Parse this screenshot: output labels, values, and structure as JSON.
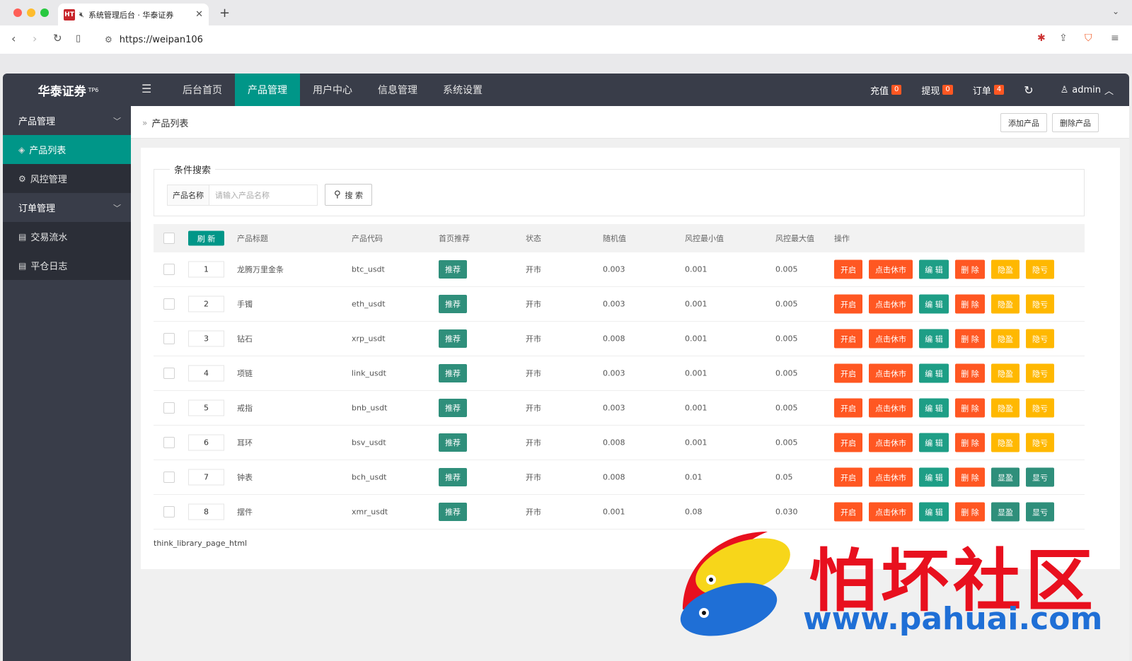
{
  "browser": {
    "tab_title": "系统管理后台 · 华泰证券",
    "tab_favicon": "HT",
    "url": "https://weipan106"
  },
  "header": {
    "logo": "华泰证券",
    "logo_sup": "TP6",
    "nav": [
      "后台首页",
      "产品管理",
      "用户中心",
      "信息管理",
      "系统设置"
    ],
    "active_nav": "产品管理",
    "recharge_label": "充值",
    "recharge_count": "0",
    "withdraw_label": "提现",
    "withdraw_count": "0",
    "order_label": "订单",
    "order_count": "4",
    "user": "admin"
  },
  "sidebar": {
    "group1": "产品管理",
    "items1": [
      "产品列表",
      "风控管理"
    ],
    "group2": "订单管理",
    "items2": [
      "交易流水",
      "平仓日志"
    ]
  },
  "breadcrumb": "产品列表",
  "actions": {
    "add": "添加产品",
    "delete": "删除产品"
  },
  "search": {
    "legend": "条件搜索",
    "label": "产品名称",
    "placeholder": "请输入产品名称",
    "button": "搜 索"
  },
  "table": {
    "refresh": "刷 新",
    "headers": [
      "产品标题",
      "产品代码",
      "首页推荐",
      "状态",
      "随机值",
      "风控最小值",
      "风控最大值",
      "操作"
    ],
    "recommend_label": "推荐",
    "op_labels": {
      "open": "开启",
      "close": "点击休市",
      "edit": "编 辑",
      "delete": "删 除",
      "hide_profit": "隐盈",
      "hide_loss": "隐亏",
      "show_profit": "显盈",
      "show_loss": "显亏"
    },
    "rows": [
      {
        "sort": "1",
        "title": "龙腾万里金条",
        "code": "btc_usdt",
        "status": "开市",
        "rand": "0.003",
        "min": "0.001",
        "max": "0.005",
        "visible": false
      },
      {
        "sort": "2",
        "title": "手镯",
        "code": "eth_usdt",
        "status": "开市",
        "rand": "0.003",
        "min": "0.001",
        "max": "0.005",
        "visible": false
      },
      {
        "sort": "3",
        "title": "钻石",
        "code": "xrp_usdt",
        "status": "开市",
        "rand": "0.008",
        "min": "0.001",
        "max": "0.005",
        "visible": false
      },
      {
        "sort": "4",
        "title": "项链",
        "code": "link_usdt",
        "status": "开市",
        "rand": "0.003",
        "min": "0.001",
        "max": "0.005",
        "visible": false
      },
      {
        "sort": "5",
        "title": "戒指",
        "code": "bnb_usdt",
        "status": "开市",
        "rand": "0.003",
        "min": "0.001",
        "max": "0.005",
        "visible": false
      },
      {
        "sort": "6",
        "title": "耳环",
        "code": "bsv_usdt",
        "status": "开市",
        "rand": "0.008",
        "min": "0.001",
        "max": "0.005",
        "visible": false
      },
      {
        "sort": "7",
        "title": "钟表",
        "code": "bch_usdt",
        "status": "开市",
        "rand": "0.008",
        "min": "0.01",
        "max": "0.05",
        "visible": true
      },
      {
        "sort": "8",
        "title": "摆件",
        "code": "xmr_usdt",
        "status": "开市",
        "rand": "0.001",
        "min": "0.08",
        "max": "0.030",
        "visible": true
      }
    ]
  },
  "pager": "think_library_page_html",
  "watermark": {
    "text": "怕坏社区",
    "url": "www.pahuai.com"
  },
  "colors": {
    "header": "#393d49",
    "accent": "#009688",
    "orange": "#ff5722",
    "yellow": "#ffb800"
  }
}
